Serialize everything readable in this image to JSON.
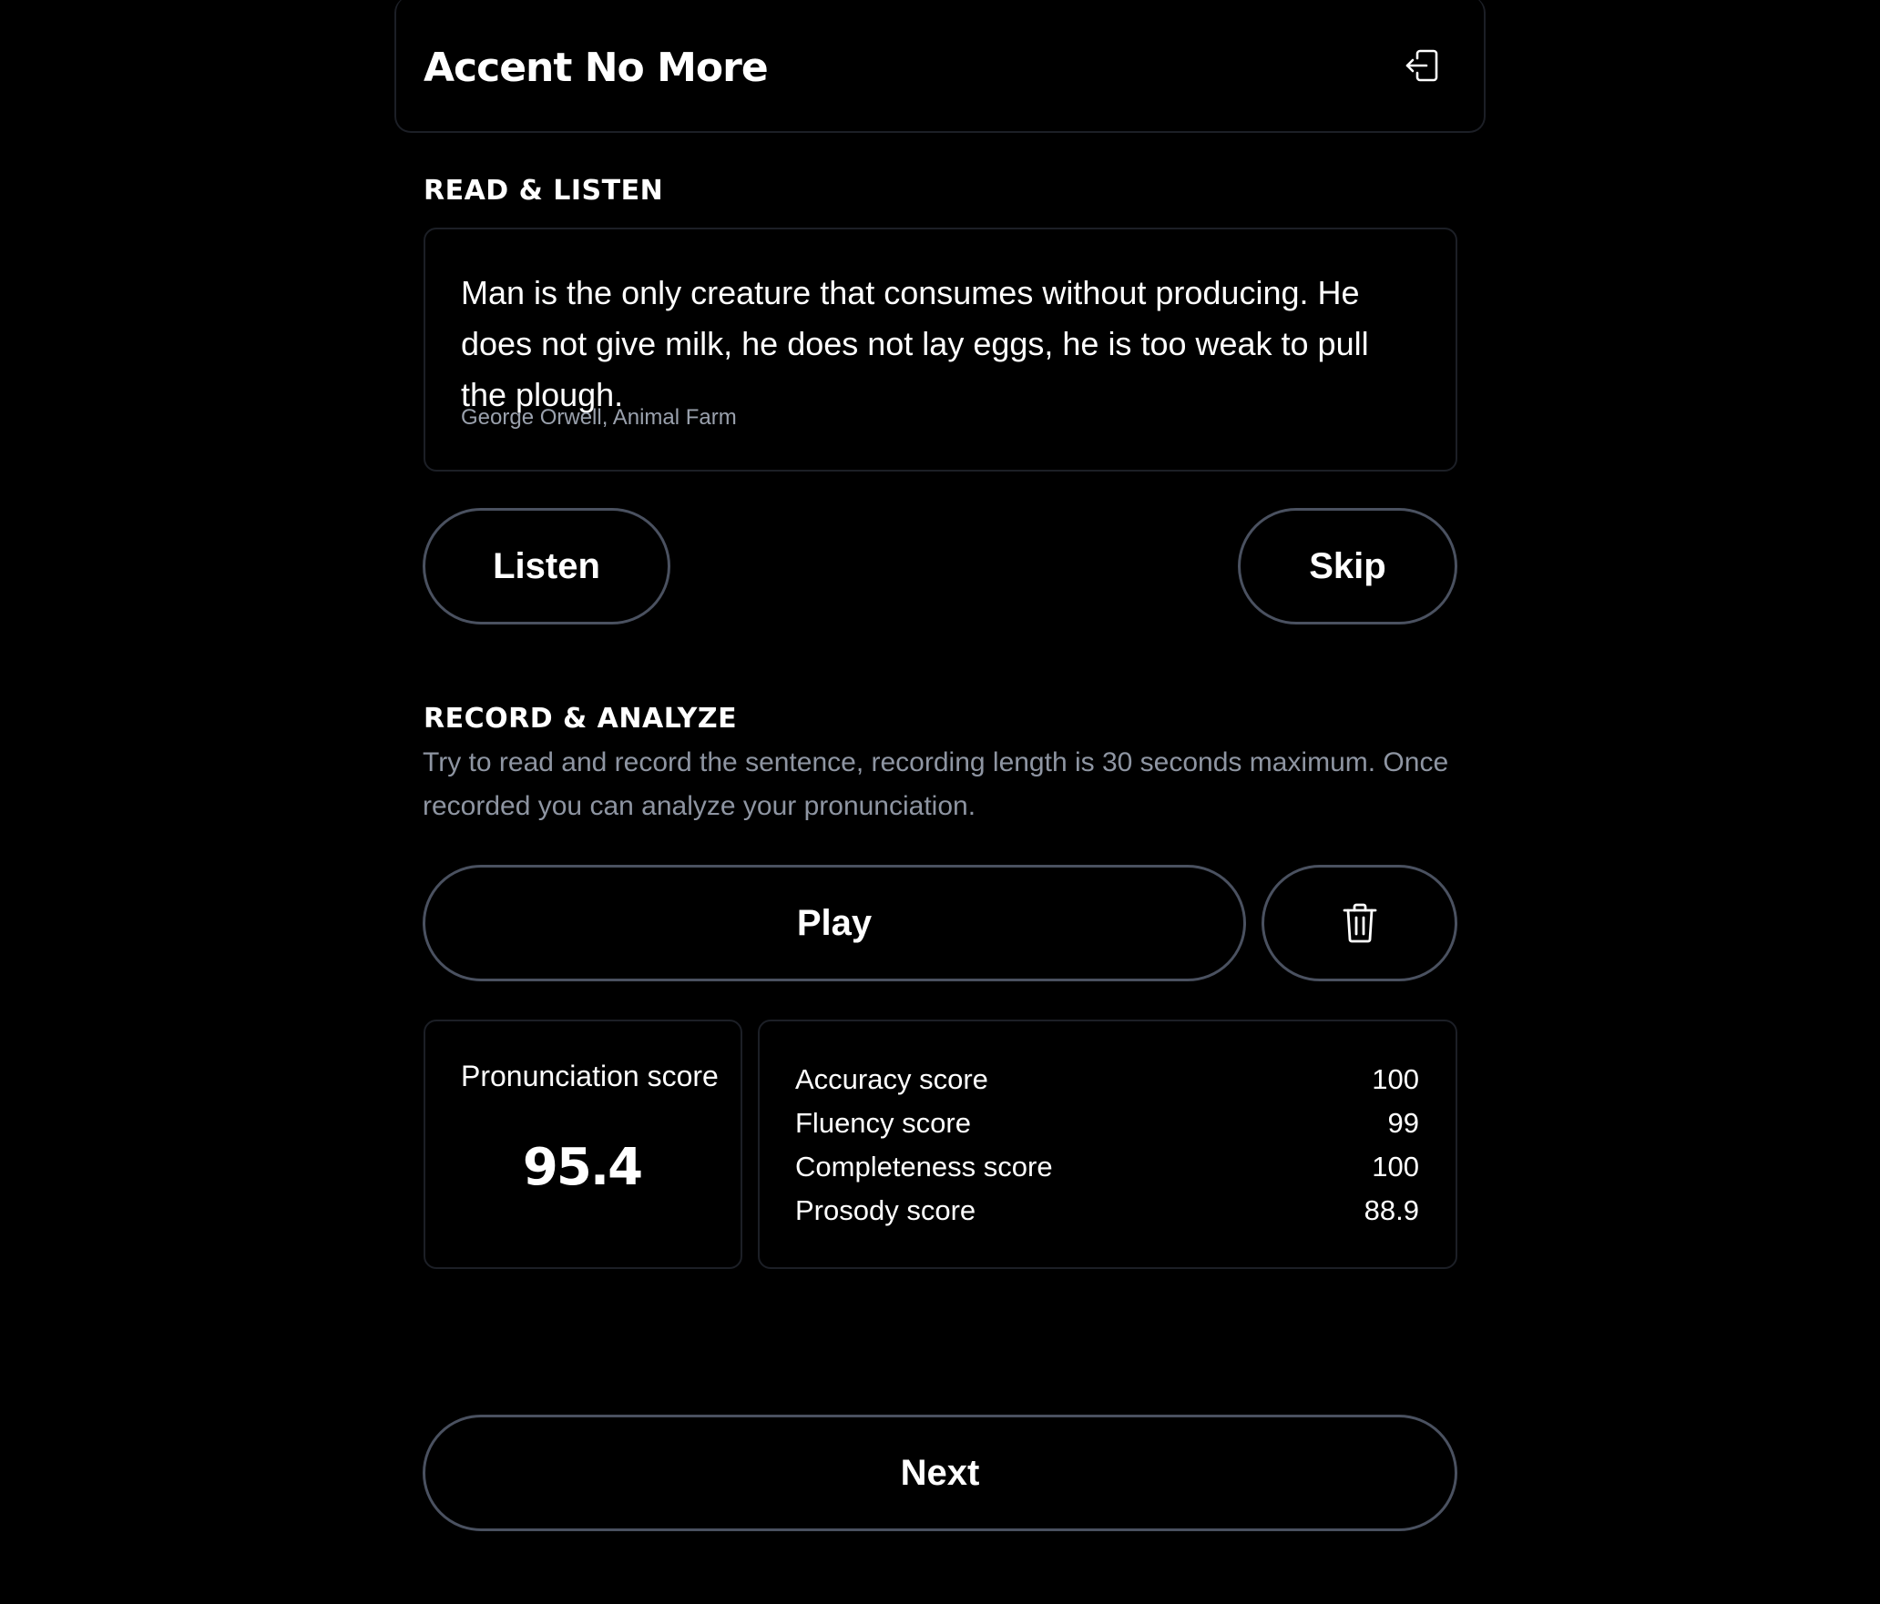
{
  "header": {
    "title": "Accent No More",
    "logout_icon": "logout-icon"
  },
  "read_listen": {
    "label": "READ & LISTEN",
    "quote": "Man is the only creature that consumes without producing. He does not give milk, he does not lay eggs, he is too weak to pull the plough.",
    "source": "George Orwell, Animal Farm",
    "listen_label": "Listen",
    "skip_label": "Skip"
  },
  "record_analyze": {
    "label": "RECORD & ANALYZE",
    "description": "Try to read and record the sentence, recording length is 30 seconds maximum. Once recorded you can analyze your pronunciation.",
    "play_label": "Play",
    "delete_icon": "trash-icon"
  },
  "scores": {
    "pronunciation_label": "Pronunciation score",
    "pronunciation_value": "95.4",
    "metrics": [
      {
        "label": "Accuracy score",
        "value": "100"
      },
      {
        "label": "Fluency score",
        "value": "99"
      },
      {
        "label": "Completeness score",
        "value": "100"
      },
      {
        "label": "Prosody score",
        "value": "88.9"
      }
    ]
  },
  "footer": {
    "next_label": "Next"
  },
  "colors": {
    "background": "#000000",
    "card_border": "#1c1f26",
    "button_border": "#4a5160",
    "muted_text": "#8e95a2"
  }
}
